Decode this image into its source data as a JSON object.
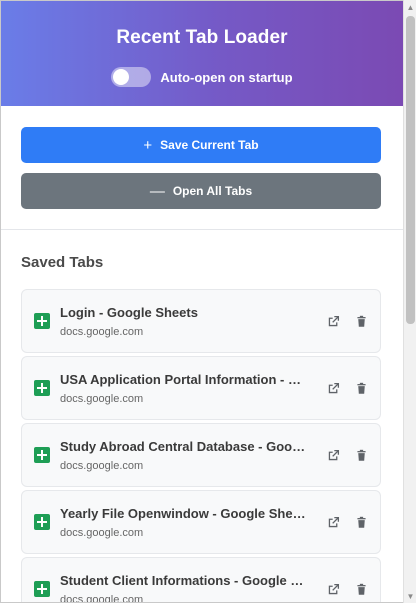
{
  "header": {
    "title": "Recent Tab Loader",
    "auto_open_label": "Auto-open on startup",
    "auto_open_enabled": false
  },
  "actions": {
    "save_label": "Save Current Tab",
    "save_glyph": "+",
    "open_all_label": "Open All Tabs",
    "open_all_glyph": "—"
  },
  "saved": {
    "heading": "Saved Tabs",
    "items": [
      {
        "title": "Login - Google Sheets",
        "domain": "docs.google.com",
        "icon": "google-sheets-icon"
      },
      {
        "title": "USA Application Portal Information - Google Sheets",
        "domain": "docs.google.com",
        "icon": "google-sheets-icon"
      },
      {
        "title": "Study Abroad Central Database - Google Sheets",
        "domain": "docs.google.com",
        "icon": "google-sheets-icon"
      },
      {
        "title": "Yearly File Openwindow - Google Sheets",
        "domain": "docs.google.com",
        "icon": "google-sheets-icon"
      },
      {
        "title": "Student Client Informations - Google Sheets",
        "domain": "docs.google.com",
        "icon": "google-sheets-icon"
      }
    ]
  },
  "colors": {
    "header_gradient_start": "#6a7de8",
    "header_gradient_end": "#7b4ab3",
    "primary": "#2f7cf6",
    "secondary": "#6c757d",
    "sheets_green": "#1e9e55"
  }
}
